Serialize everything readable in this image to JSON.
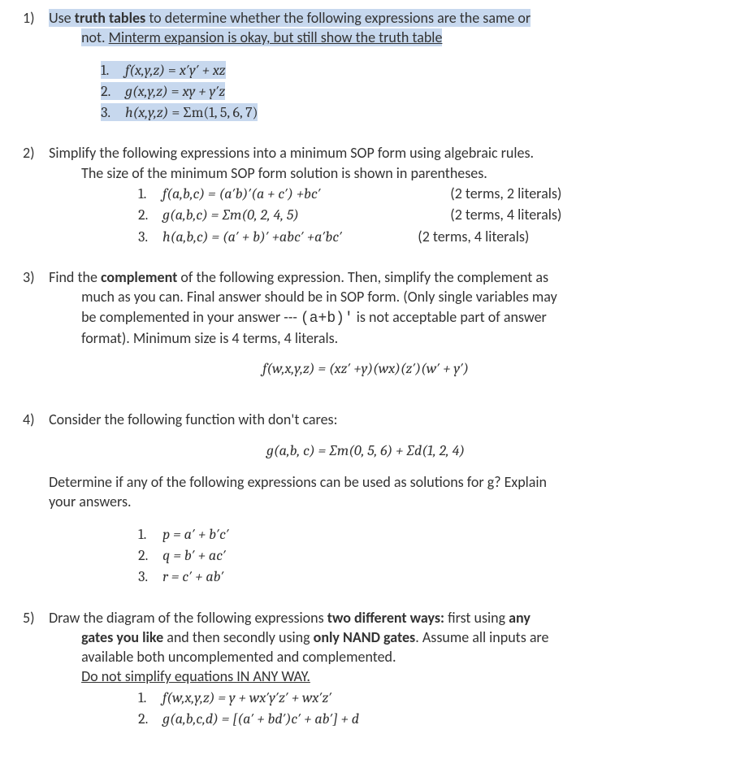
{
  "p1": {
    "num": "1)",
    "t1": "Use ",
    "tt": "truth tables",
    "t2": " to determine whether the following expressions are the same or",
    "t3": "not. ",
    "t4": "Minterm expansion is okay, but still show the truth table",
    "items": [
      {
        "n": "1.",
        "lhs": "f(x,y,z)",
        "eq": " = ",
        "rhs": "x′y′ + xz"
      },
      {
        "n": "2.",
        "lhs": "g(x,y,z)",
        "eq": " = ",
        "rhs": "xy + y′z"
      },
      {
        "n": "3.",
        "lhs": "h(x,y,z)",
        "eq": " = ",
        "rhs": "Σm(1, 5, 6, 7)"
      }
    ]
  },
  "p2": {
    "num": "2)",
    "t1": "Simplify the following expressions into a minimum SOP form using algebraic rules.",
    "t2": "The size of the minimum SOP form solution is shown in parentheses.",
    "items": [
      {
        "n": "1.",
        "expr": "f(a,b,c) = (a′b)′(a + c′) +bc′",
        "note": "(2 terms, 2 literals)"
      },
      {
        "n": "2.",
        "expr": "g(a,b,c) = ∑m(0, 2, 4, 5)",
        "note": "(2 terms, 4 literals)"
      },
      {
        "n": "3.",
        "expr": "h(a,b,c) = (a′ + b)′ +abc′ +a′bc′",
        "note": "(2 terms, 4 literals)"
      }
    ]
  },
  "p3": {
    "num": "3)",
    "t1a": "Find the ",
    "t1b": "complement",
    "t1c": " of the following expression. Then, simplify the complement as",
    "t2": "much as you can.  Final answer should be in SOP form. (Only single variables may",
    "t3a": "be complemented in your answer --- ",
    "t3code": "(a+b)′",
    "t3b": " is not acceptable part of answer",
    "t4": "format). Minimum size is 4 terms, 4 literals.",
    "eq": "f(w,x,y,z) = (xz′ +y)(wx)(z′)(w′ + y′)"
  },
  "p4": {
    "num": "4)",
    "t1": "Consider the following function with don't cares:",
    "eq": "g(a,b, c) = ∑m(0, 5, 6) + ∑d(1, 2, 4)",
    "t2": "Determine if any of the following expressions can be used as solutions for g? Explain",
    "t3": "your answers.",
    "items": [
      {
        "n": "1.",
        "expr": "p = a′ + b′c′"
      },
      {
        "n": "2.",
        "expr": "q = b′ + ac′"
      },
      {
        "n": "3.",
        "expr": "r = c′ + ab′"
      }
    ]
  },
  "p5": {
    "num": "5)",
    "t1a": "Draw the diagram of the following expressions ",
    "t1b": "two different ways:",
    "t1c": " first using ",
    "t1d": "any",
    "t2a": "gates you like",
    "t2b": " and then secondly using ",
    "t2c": "only NAND gates",
    "t2d": ". Assume all inputs are",
    "t3": "available both uncomplemented and complemented.",
    "t4": "Do not simplify equations IN ANY WAY.",
    "items": [
      {
        "n": "1.",
        "expr": "f(w,x,y,z) = y + wx′y′z′ + wx′z′"
      },
      {
        "n": "2.",
        "expr": "g(a,b,c,d) = [(a′ + bd′)c′ + ab′] + d"
      }
    ]
  }
}
